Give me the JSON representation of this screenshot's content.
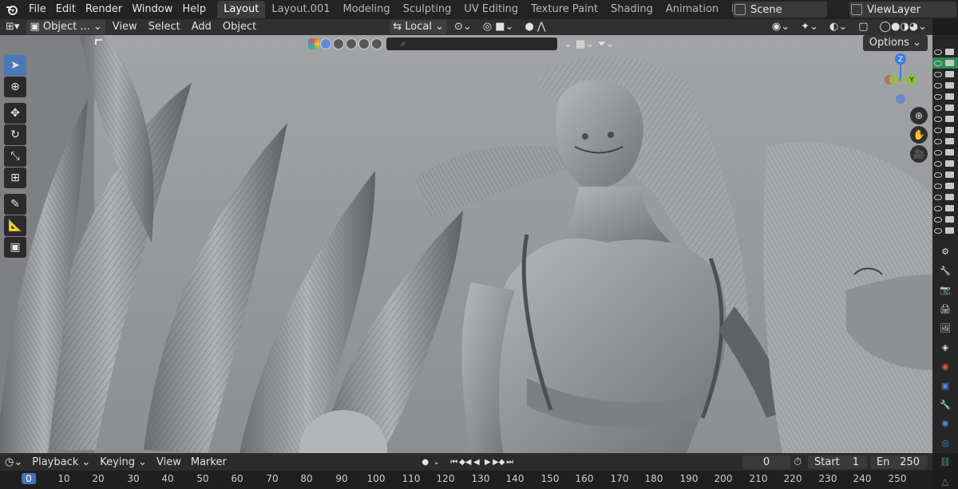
{
  "menubar": {
    "items": [
      "File",
      "Edit",
      "Render",
      "Window",
      "Help"
    ],
    "workspaces": [
      "Layout",
      "Layout.001",
      "Modeling",
      "Sculpting",
      "UV Editing",
      "Texture Paint",
      "Shading",
      "Animation",
      "Rend"
    ],
    "active_workspace": "Layout",
    "scene": "Scene",
    "view_layer": "ViewLayer"
  },
  "viewport_header": {
    "mode": "Object ...",
    "menus": [
      "View",
      "Select",
      "Add",
      "Object"
    ],
    "transform_orientation": "Local",
    "options_label": "Options"
  },
  "timeline": {
    "menus": [
      "Playback",
      "Keying",
      "View",
      "Marker"
    ],
    "current_frame": "0",
    "start_label": "Start",
    "start_value": "1",
    "end_label": "En",
    "end_value": "250"
  },
  "ruler": {
    "current": "0",
    "ticks": [
      "10",
      "20",
      "30",
      "40",
      "50",
      "60",
      "70",
      "80",
      "90",
      "100",
      "110",
      "120",
      "130",
      "140",
      "150",
      "160",
      "170",
      "180",
      "190",
      "200",
      "210",
      "220",
      "230",
      "240",
      "250"
    ]
  },
  "gizmo": {
    "z": "Z",
    "y": "Y"
  },
  "colors": {
    "accent": "#4772b3",
    "viewport_bg": "#8f9194",
    "outliner_highlight": "#2f8a54"
  }
}
